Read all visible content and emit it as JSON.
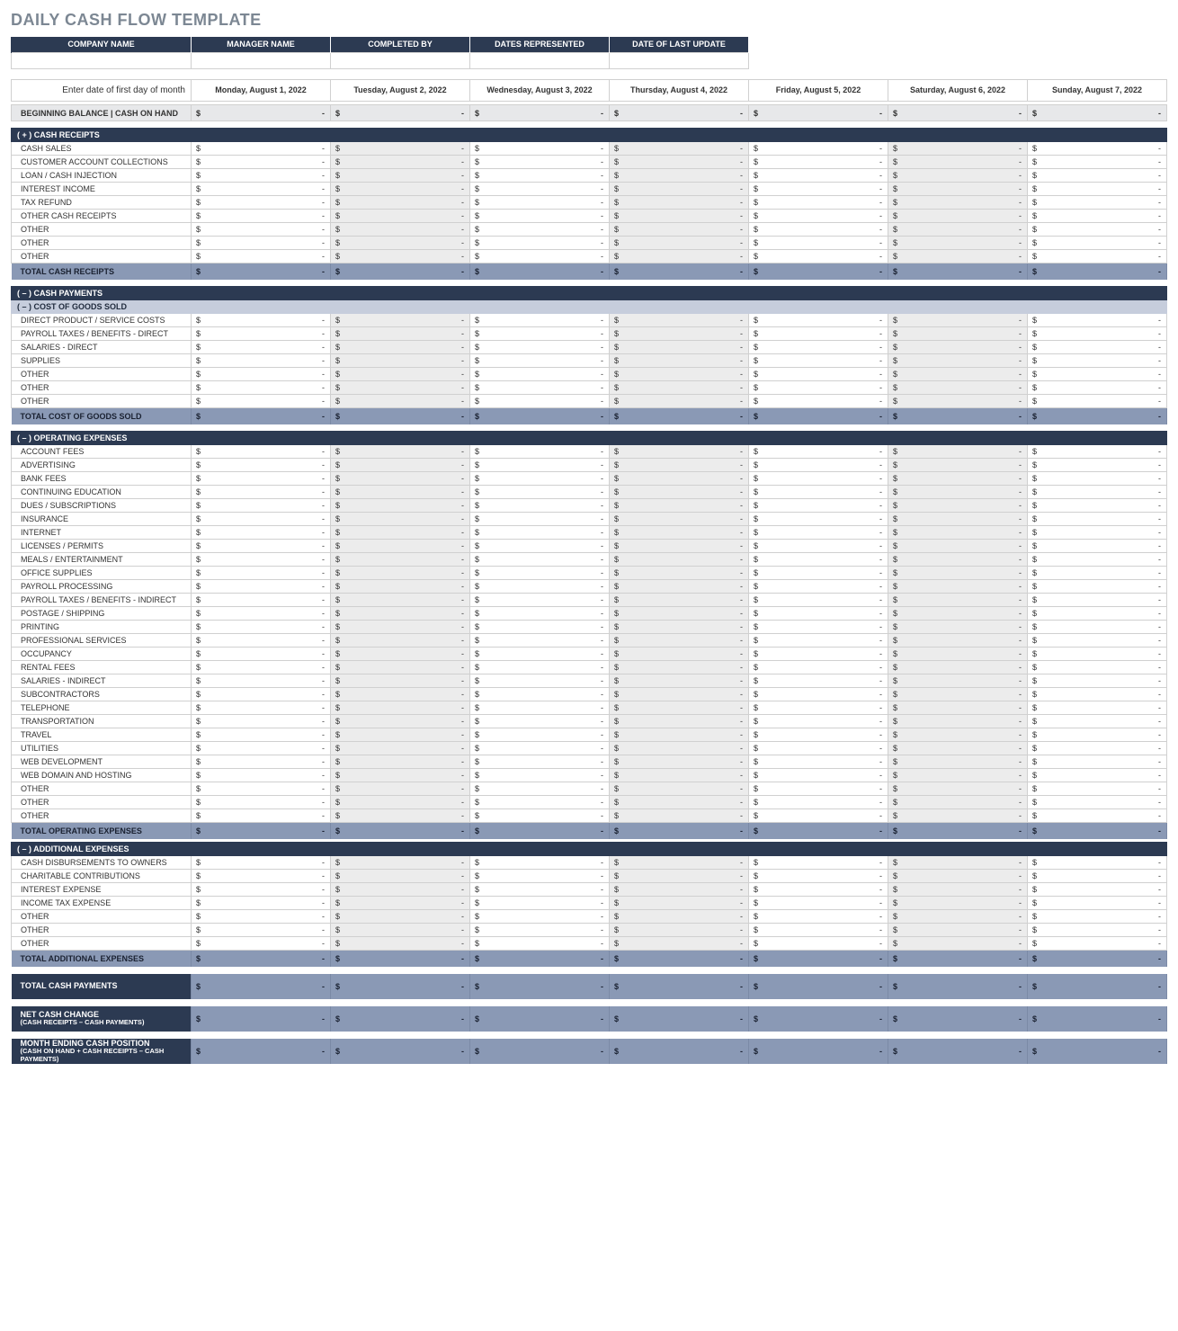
{
  "title": "DAILY CASH FLOW TEMPLATE",
  "info_headers": [
    "COMPANY NAME",
    "MANAGER NAME",
    "COMPLETED BY",
    "DATES REPRESENTED",
    "DATE OF LAST UPDATE"
  ],
  "info_values": [
    "",
    "",
    "",
    "",
    ""
  ],
  "date_prompt": "Enter date of first day of month",
  "dates": [
    "Monday, August 1, 2022",
    "Tuesday, August 2, 2022",
    "Wednesday, August 3, 2022",
    "Thursday, August 4, 2022",
    "Friday, August 5, 2022",
    "Saturday, August 6, 2022",
    "Sunday, August 7, 2022"
  ],
  "beginning_balance_label": "BEGINNING BALANCE  |  CASH ON HAND",
  "currency": "$",
  "dash": "-",
  "sections": {
    "receipts": {
      "header": "( + )  CASH RECEIPTS",
      "items": [
        "CASH SALES",
        "CUSTOMER ACCOUNT COLLECTIONS",
        "LOAN / CASH INJECTION",
        "INTEREST INCOME",
        "TAX REFUND",
        "OTHER CASH RECEIPTS",
        "OTHER",
        "OTHER",
        "OTHER"
      ],
      "total": "TOTAL CASH RECEIPTS"
    },
    "payments_header": "( – )  CASH PAYMENTS",
    "cogs": {
      "header": "( – )  COST OF GOODS SOLD",
      "items": [
        "DIRECT PRODUCT / SERVICE COSTS",
        "PAYROLL TAXES / BENEFITS - DIRECT",
        "SALARIES - DIRECT",
        "SUPPLIES",
        "OTHER",
        "OTHER",
        "OTHER"
      ],
      "total": "TOTAL COST OF GOODS SOLD"
    },
    "opex": {
      "header": "( – )  OPERATING EXPENSES",
      "items": [
        "ACCOUNT FEES",
        "ADVERTISING",
        "BANK FEES",
        "CONTINUING EDUCATION",
        "DUES / SUBSCRIPTIONS",
        "INSURANCE",
        "INTERNET",
        "LICENSES / PERMITS",
        "MEALS / ENTERTAINMENT",
        "OFFICE SUPPLIES",
        "PAYROLL PROCESSING",
        "PAYROLL TAXES / BENEFITS - INDIRECT",
        "POSTAGE / SHIPPING",
        "PRINTING",
        "PROFESSIONAL SERVICES",
        "OCCUPANCY",
        "RENTAL FEES",
        "SALARIES - INDIRECT",
        "SUBCONTRACTORS",
        "TELEPHONE",
        "TRANSPORTATION",
        "TRAVEL",
        "UTILITIES",
        "WEB DEVELOPMENT",
        "WEB DOMAIN AND HOSTING",
        "OTHER",
        "OTHER",
        "OTHER"
      ],
      "total": "TOTAL OPERATING EXPENSES"
    },
    "addl": {
      "header": "( – )  ADDITIONAL EXPENSES",
      "items": [
        "CASH DISBURSEMENTS TO OWNERS",
        "CHARITABLE CONTRIBUTIONS",
        "INTEREST EXPENSE",
        "INCOME TAX EXPENSE",
        "OTHER",
        "OTHER",
        "OTHER"
      ],
      "total": "TOTAL ADDITIONAL EXPENSES"
    }
  },
  "summaries": [
    {
      "title": "TOTAL CASH PAYMENTS",
      "sub": ""
    },
    {
      "title": "NET CASH CHANGE",
      "sub": "(CASH RECEIPTS – CASH PAYMENTS)"
    },
    {
      "title": "MONTH ENDING CASH POSITION",
      "sub": "(CASH ON HAND + CASH RECEIPTS – CASH PAYMENTS)"
    }
  ]
}
